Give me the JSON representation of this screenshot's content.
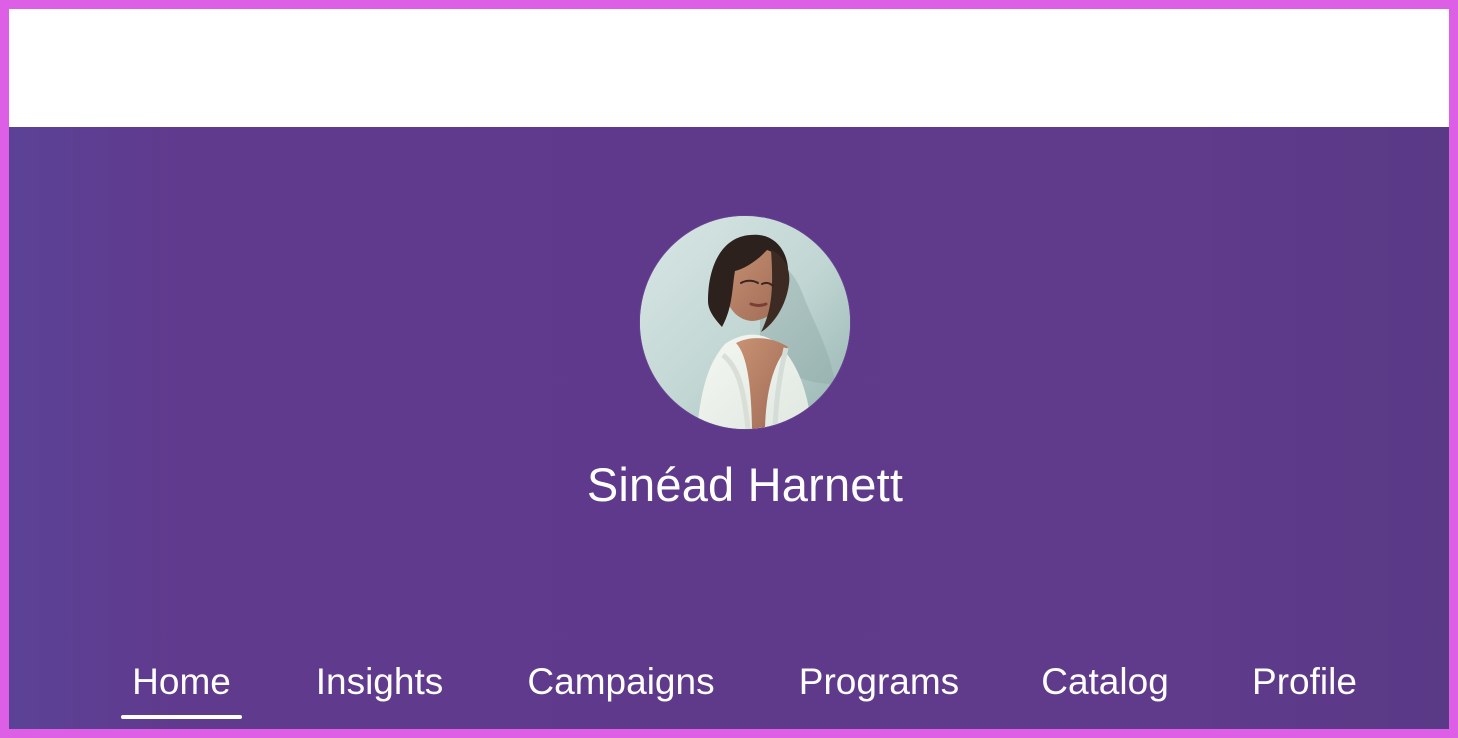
{
  "profile": {
    "name": "Sinéad Harnett",
    "avatar_icon": "user-avatar-photo"
  },
  "nav": {
    "active": "Home",
    "tabs": [
      {
        "label": "Home"
      },
      {
        "label": "Insights"
      },
      {
        "label": "Campaigns"
      },
      {
        "label": "Programs"
      },
      {
        "label": "Catalog"
      },
      {
        "label": "Profile"
      }
    ]
  },
  "colors": {
    "frame": "#dc5fe6",
    "hero_gradient_left": "#5b4296",
    "hero_gradient_center": "#5f3a8b",
    "hero_gradient_right": "#593a87",
    "text": "#ffffff",
    "active_indicator": "#ffffff"
  }
}
